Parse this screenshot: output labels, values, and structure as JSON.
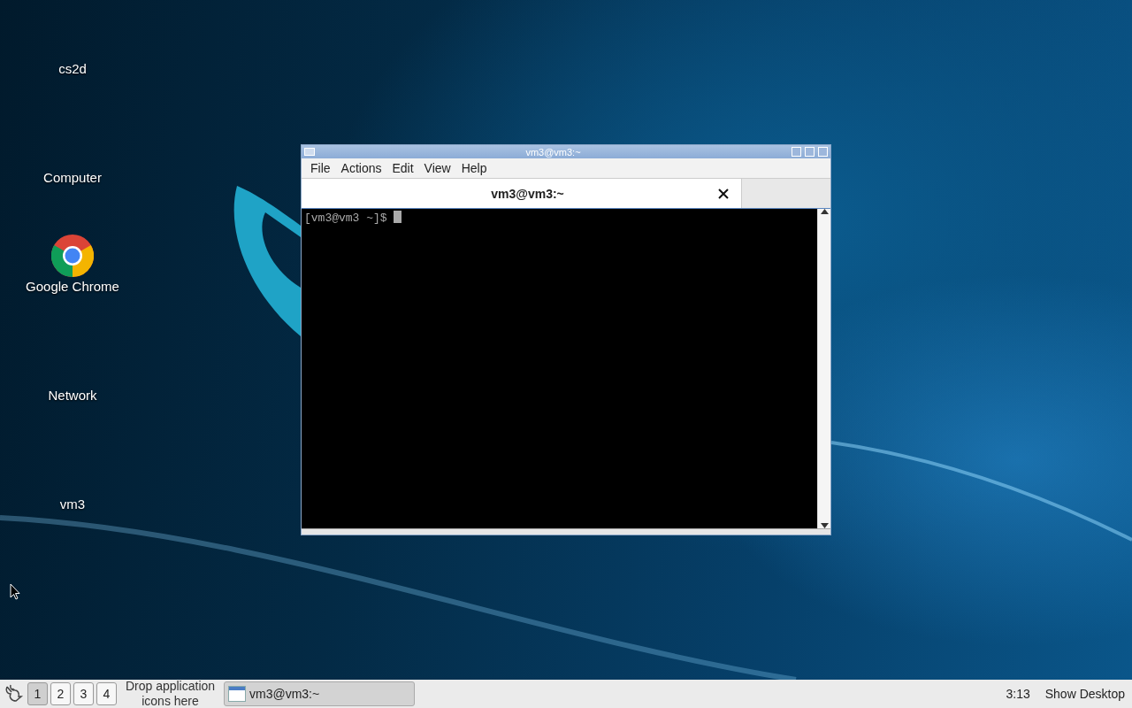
{
  "desktop_icons": [
    {
      "kind": "blank",
      "label": "cs2d"
    },
    {
      "kind": "blank",
      "label": "Computer"
    },
    {
      "kind": "chrome",
      "label": "Google Chrome"
    },
    {
      "kind": "blank",
      "label": "Network"
    },
    {
      "kind": "blank",
      "label": "vm3"
    }
  ],
  "window": {
    "title": "vm3@vm3:~",
    "menu": [
      "File",
      "Actions",
      "Edit",
      "View",
      "Help"
    ],
    "tabs": [
      {
        "label": "vm3@vm3:~",
        "selected": true
      }
    ],
    "terminal": {
      "prompt": "[vm3@vm3 ~]$ "
    }
  },
  "taskbar": {
    "workspaces": [
      {
        "label": "1",
        "selected": true
      },
      {
        "label": "2",
        "selected": false
      },
      {
        "label": "3",
        "selected": false
      },
      {
        "label": "4",
        "selected": false
      }
    ],
    "launcher_hint": "Drop application icons here",
    "tasks": [
      {
        "label": "vm3@vm3:~",
        "selected": true
      }
    ],
    "clock": "3:13",
    "show_desktop": "Show Desktop"
  }
}
